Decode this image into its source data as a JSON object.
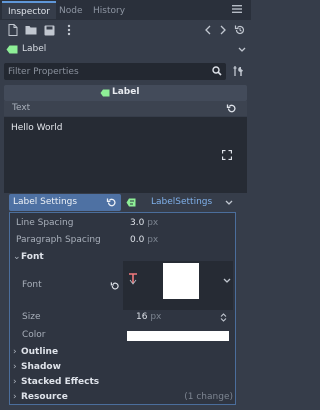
{
  "tabs": [
    {
      "label": "Inspector",
      "active": true
    },
    {
      "label": "Node",
      "active": false
    },
    {
      "label": "History",
      "active": false
    }
  ],
  "object": {
    "label": "Label"
  },
  "filter": {
    "placeholder": "Filter Properties"
  },
  "category": {
    "label": "Label"
  },
  "text_section": {
    "label": "Text",
    "value": "Hello World"
  },
  "label_settings": {
    "label": "Label Settings",
    "resource": "LabelSettings"
  },
  "properties": {
    "line_spacing": {
      "label": "Line Spacing",
      "value": "3.0",
      "unit": "px"
    },
    "paragraph_spacing": {
      "label": "Paragraph Spacing",
      "value": "0.0",
      "unit": "px"
    },
    "font_group": "Font",
    "font": {
      "label": "Font"
    },
    "size": {
      "label": "Size",
      "value": "16",
      "unit": "px"
    },
    "color": {
      "label": "Color",
      "hex": "#ffffff"
    }
  },
  "groups": {
    "outline": "Outline",
    "shadow": "Shadow",
    "stacked_effects": "Stacked Effects",
    "resource": "Resource",
    "resource_note": "(1 change)"
  },
  "colors": {
    "accent": "#5f97d8",
    "label_settings_bg": "#4e71a3",
    "node_green": "#8eef97"
  }
}
